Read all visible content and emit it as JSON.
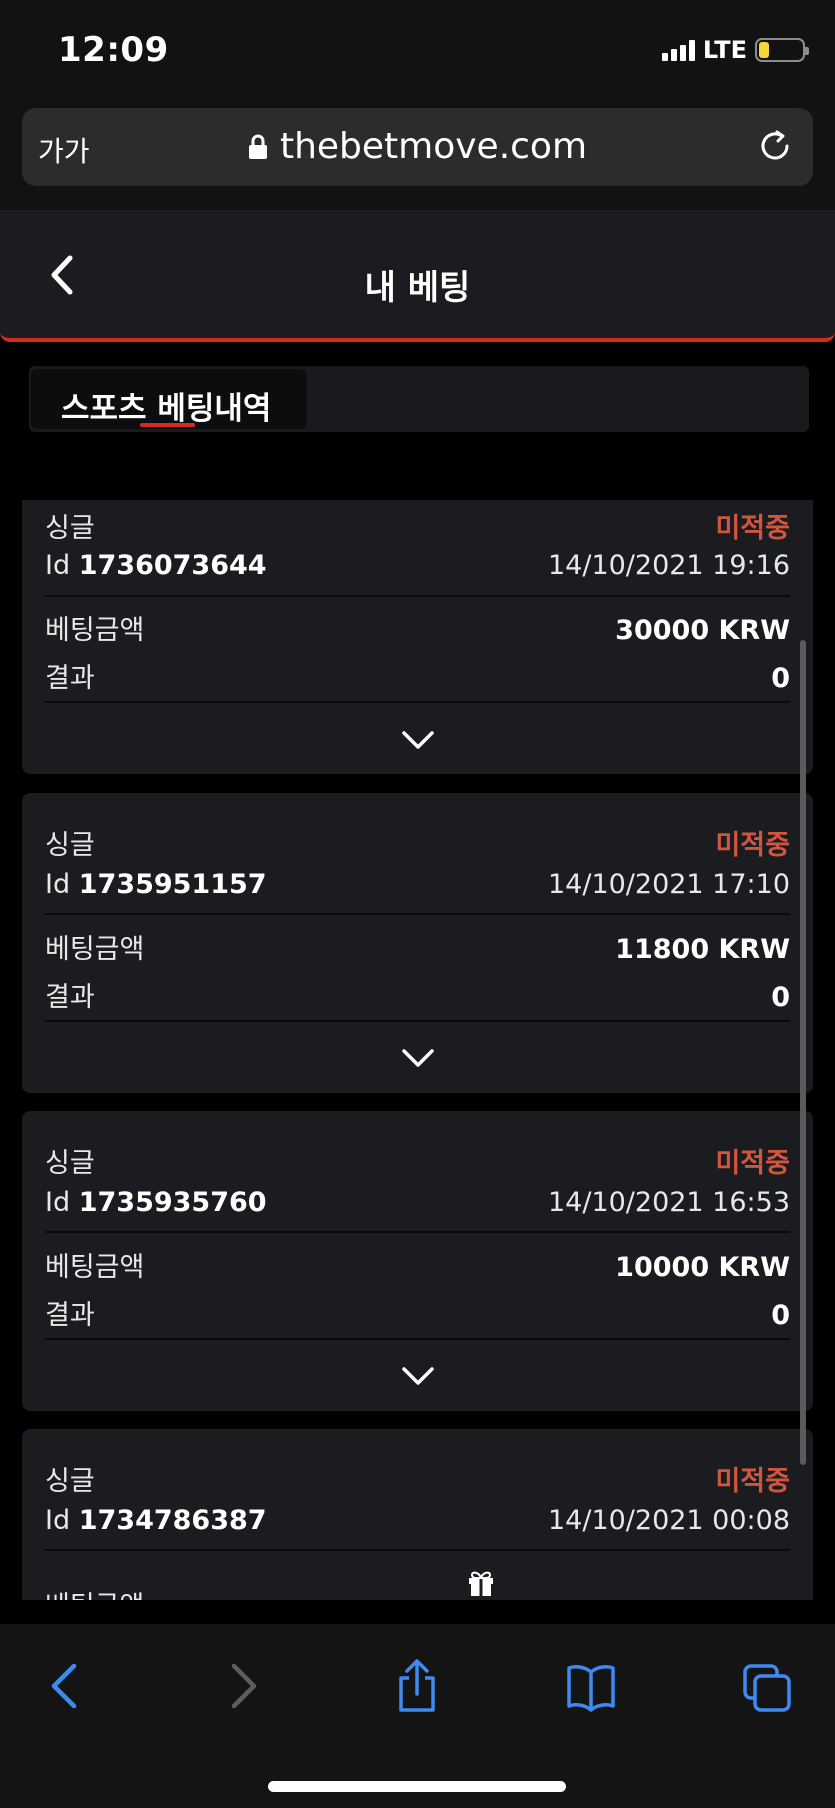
{
  "status_bar": {
    "time": "12:09",
    "network": "LTE"
  },
  "browser": {
    "text_size_label": "가가",
    "url": "thebetmove.com"
  },
  "header": {
    "title": "내 베팅"
  },
  "tabs": [
    {
      "label": "스포츠 베팅내역",
      "active": true
    }
  ],
  "bets": [
    {
      "type": "싱글",
      "status": "미적중",
      "id_label": "Id",
      "id": "1736073644",
      "datetime": "14/10/2021 19:16",
      "amount_label": "베팅금액",
      "amount": "30000 KRW",
      "result_label": "결과",
      "result": "0"
    },
    {
      "type": "싱글",
      "status": "미적중",
      "id_label": "Id",
      "id": "1735951157",
      "datetime": "14/10/2021 17:10",
      "amount_label": "베팅금액",
      "amount": "11800 KRW",
      "result_label": "결과",
      "result": "0"
    },
    {
      "type": "싱글",
      "status": "미적중",
      "id_label": "Id",
      "id": "1735935760",
      "datetime": "14/10/2021 16:53",
      "amount_label": "베팅금액",
      "amount": "10000 KRW",
      "result_label": "결과",
      "result": "0"
    },
    {
      "type": "싱글",
      "status": "미적중",
      "id_label": "Id",
      "id": "1734786387",
      "datetime": "14/10/2021 00:08",
      "amount_label": "베팅금액"
    }
  ],
  "colors": {
    "accent_red": "#d72a1f",
    "status_red": "#d2553e",
    "card_bg": "#1b1c20",
    "ios_blue": "#3d8bf2"
  },
  "icons": {
    "back": "chevron-left-icon",
    "expand": "chevron-down-icon",
    "lock": "lock-icon",
    "reload": "reload-icon",
    "gift": "gift-icon",
    "share": "share-icon",
    "bookmarks": "book-icon",
    "tabs": "tabs-icon"
  }
}
